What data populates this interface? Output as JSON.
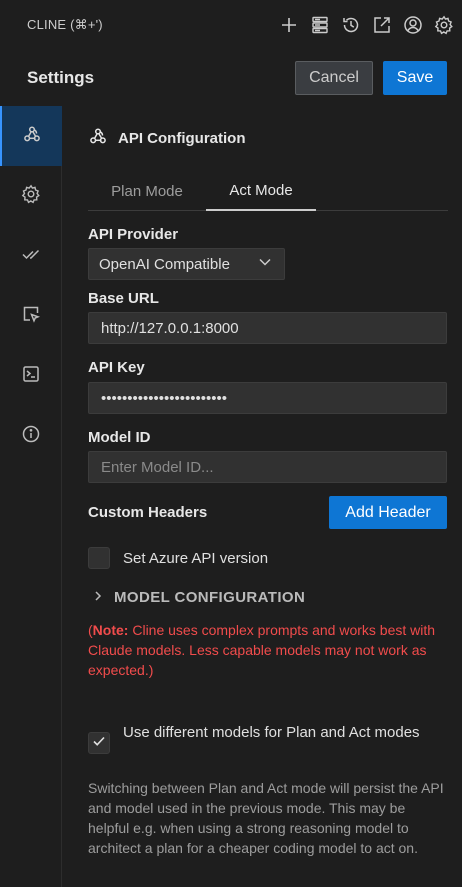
{
  "topbar": {
    "title": "CLINE (⌘+')",
    "actions": [
      "plus-icon",
      "server-icon",
      "history-icon",
      "external-link-icon",
      "account-icon",
      "gear-icon"
    ]
  },
  "header": {
    "title": "Settings",
    "cancel_label": "Cancel",
    "save_label": "Save"
  },
  "sidebar": {
    "items": [
      {
        "icon": "webhook-icon",
        "active": true
      },
      {
        "icon": "gear-icon"
      },
      {
        "icon": "check-all-icon"
      },
      {
        "icon": "browser-cursor-icon"
      },
      {
        "icon": "terminal-icon"
      },
      {
        "icon": "info-icon"
      }
    ]
  },
  "main": {
    "section_title": "API Configuration",
    "tabs": [
      {
        "label": "Plan Mode",
        "active": false
      },
      {
        "label": "Act Mode",
        "active": true
      }
    ],
    "api_provider": {
      "label": "API Provider",
      "value": "OpenAI Compatible"
    },
    "base_url": {
      "label": "Base URL",
      "value": "http://127.0.0.1:8000"
    },
    "api_key": {
      "label": "API Key",
      "value": "••••••••••••••••••••••••"
    },
    "model_id": {
      "label": "Model ID",
      "placeholder": "Enter Model ID..."
    },
    "custom_headers": {
      "label": "Custom Headers",
      "button": "Add Header"
    },
    "azure": {
      "label": "Set Azure API version",
      "checked": false
    },
    "model_config": {
      "label": "MODEL CONFIGURATION"
    },
    "note": {
      "prefix": "(",
      "bold": "Note:",
      "text": " Cline uses complex prompts and works best with Claude models. Less capable models may not work as expected.)"
    },
    "diff_models": {
      "label": "Use different models for Plan and Act modes",
      "checked": true
    },
    "help_text": "Switching between Plan and Act mode will persist the API and model used in the previous mode. This may be helpful e.g. when using a strong reasoning model to architect a plan for a cheaper coding model to act on."
  },
  "colors": {
    "background": "#1e1e1e",
    "accent": "#0e76d4",
    "warning": "#f14c4c",
    "sidebar_active": "#14375a"
  }
}
